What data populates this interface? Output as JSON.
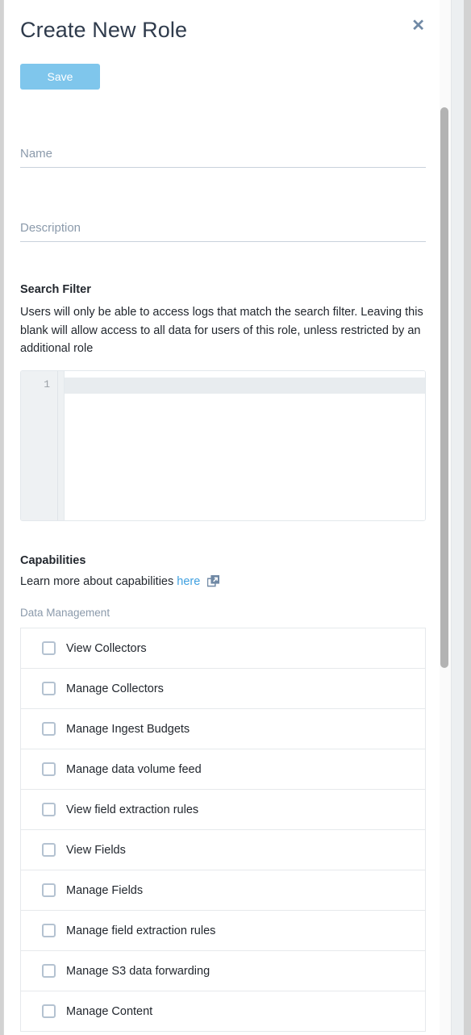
{
  "dialog": {
    "title": "Create New Role",
    "close_icon": "close-icon",
    "save_label": "Save"
  },
  "form": {
    "name": {
      "value": "",
      "placeholder": "Name"
    },
    "description": {
      "value": "",
      "placeholder": "Description"
    }
  },
  "search_filter": {
    "heading": "Search Filter",
    "description": "Users will only be able to access logs that match the search filter. Leaving this blank will allow access to all data for users of this role, unless restricted by an additional role",
    "editor": {
      "line_number": "1",
      "content": ""
    }
  },
  "capabilities": {
    "heading": "Capabilities",
    "subtext_prefix": "Learn more about capabilities ",
    "link_label": "here",
    "link_icon": "external-link-icon",
    "group_label": "Data Management",
    "items": [
      {
        "label": "View Collectors",
        "checked": false
      },
      {
        "label": "Manage Collectors",
        "checked": false
      },
      {
        "label": "Manage Ingest Budgets",
        "checked": false
      },
      {
        "label": "Manage data volume feed",
        "checked": false
      },
      {
        "label": "View field extraction rules",
        "checked": false
      },
      {
        "label": "View Fields",
        "checked": false
      },
      {
        "label": "Manage Fields",
        "checked": false
      },
      {
        "label": "Manage field extraction rules",
        "checked": false
      },
      {
        "label": "Manage S3 data forwarding",
        "checked": false
      },
      {
        "label": "Manage Content",
        "checked": false
      }
    ]
  },
  "colors": {
    "accent_blue": "#7fc6ec",
    "link_blue": "#3fa0e0",
    "title_text": "#2f3b4c",
    "muted_text": "#8b9aab",
    "checkbox_border": "#b4c2d1"
  }
}
